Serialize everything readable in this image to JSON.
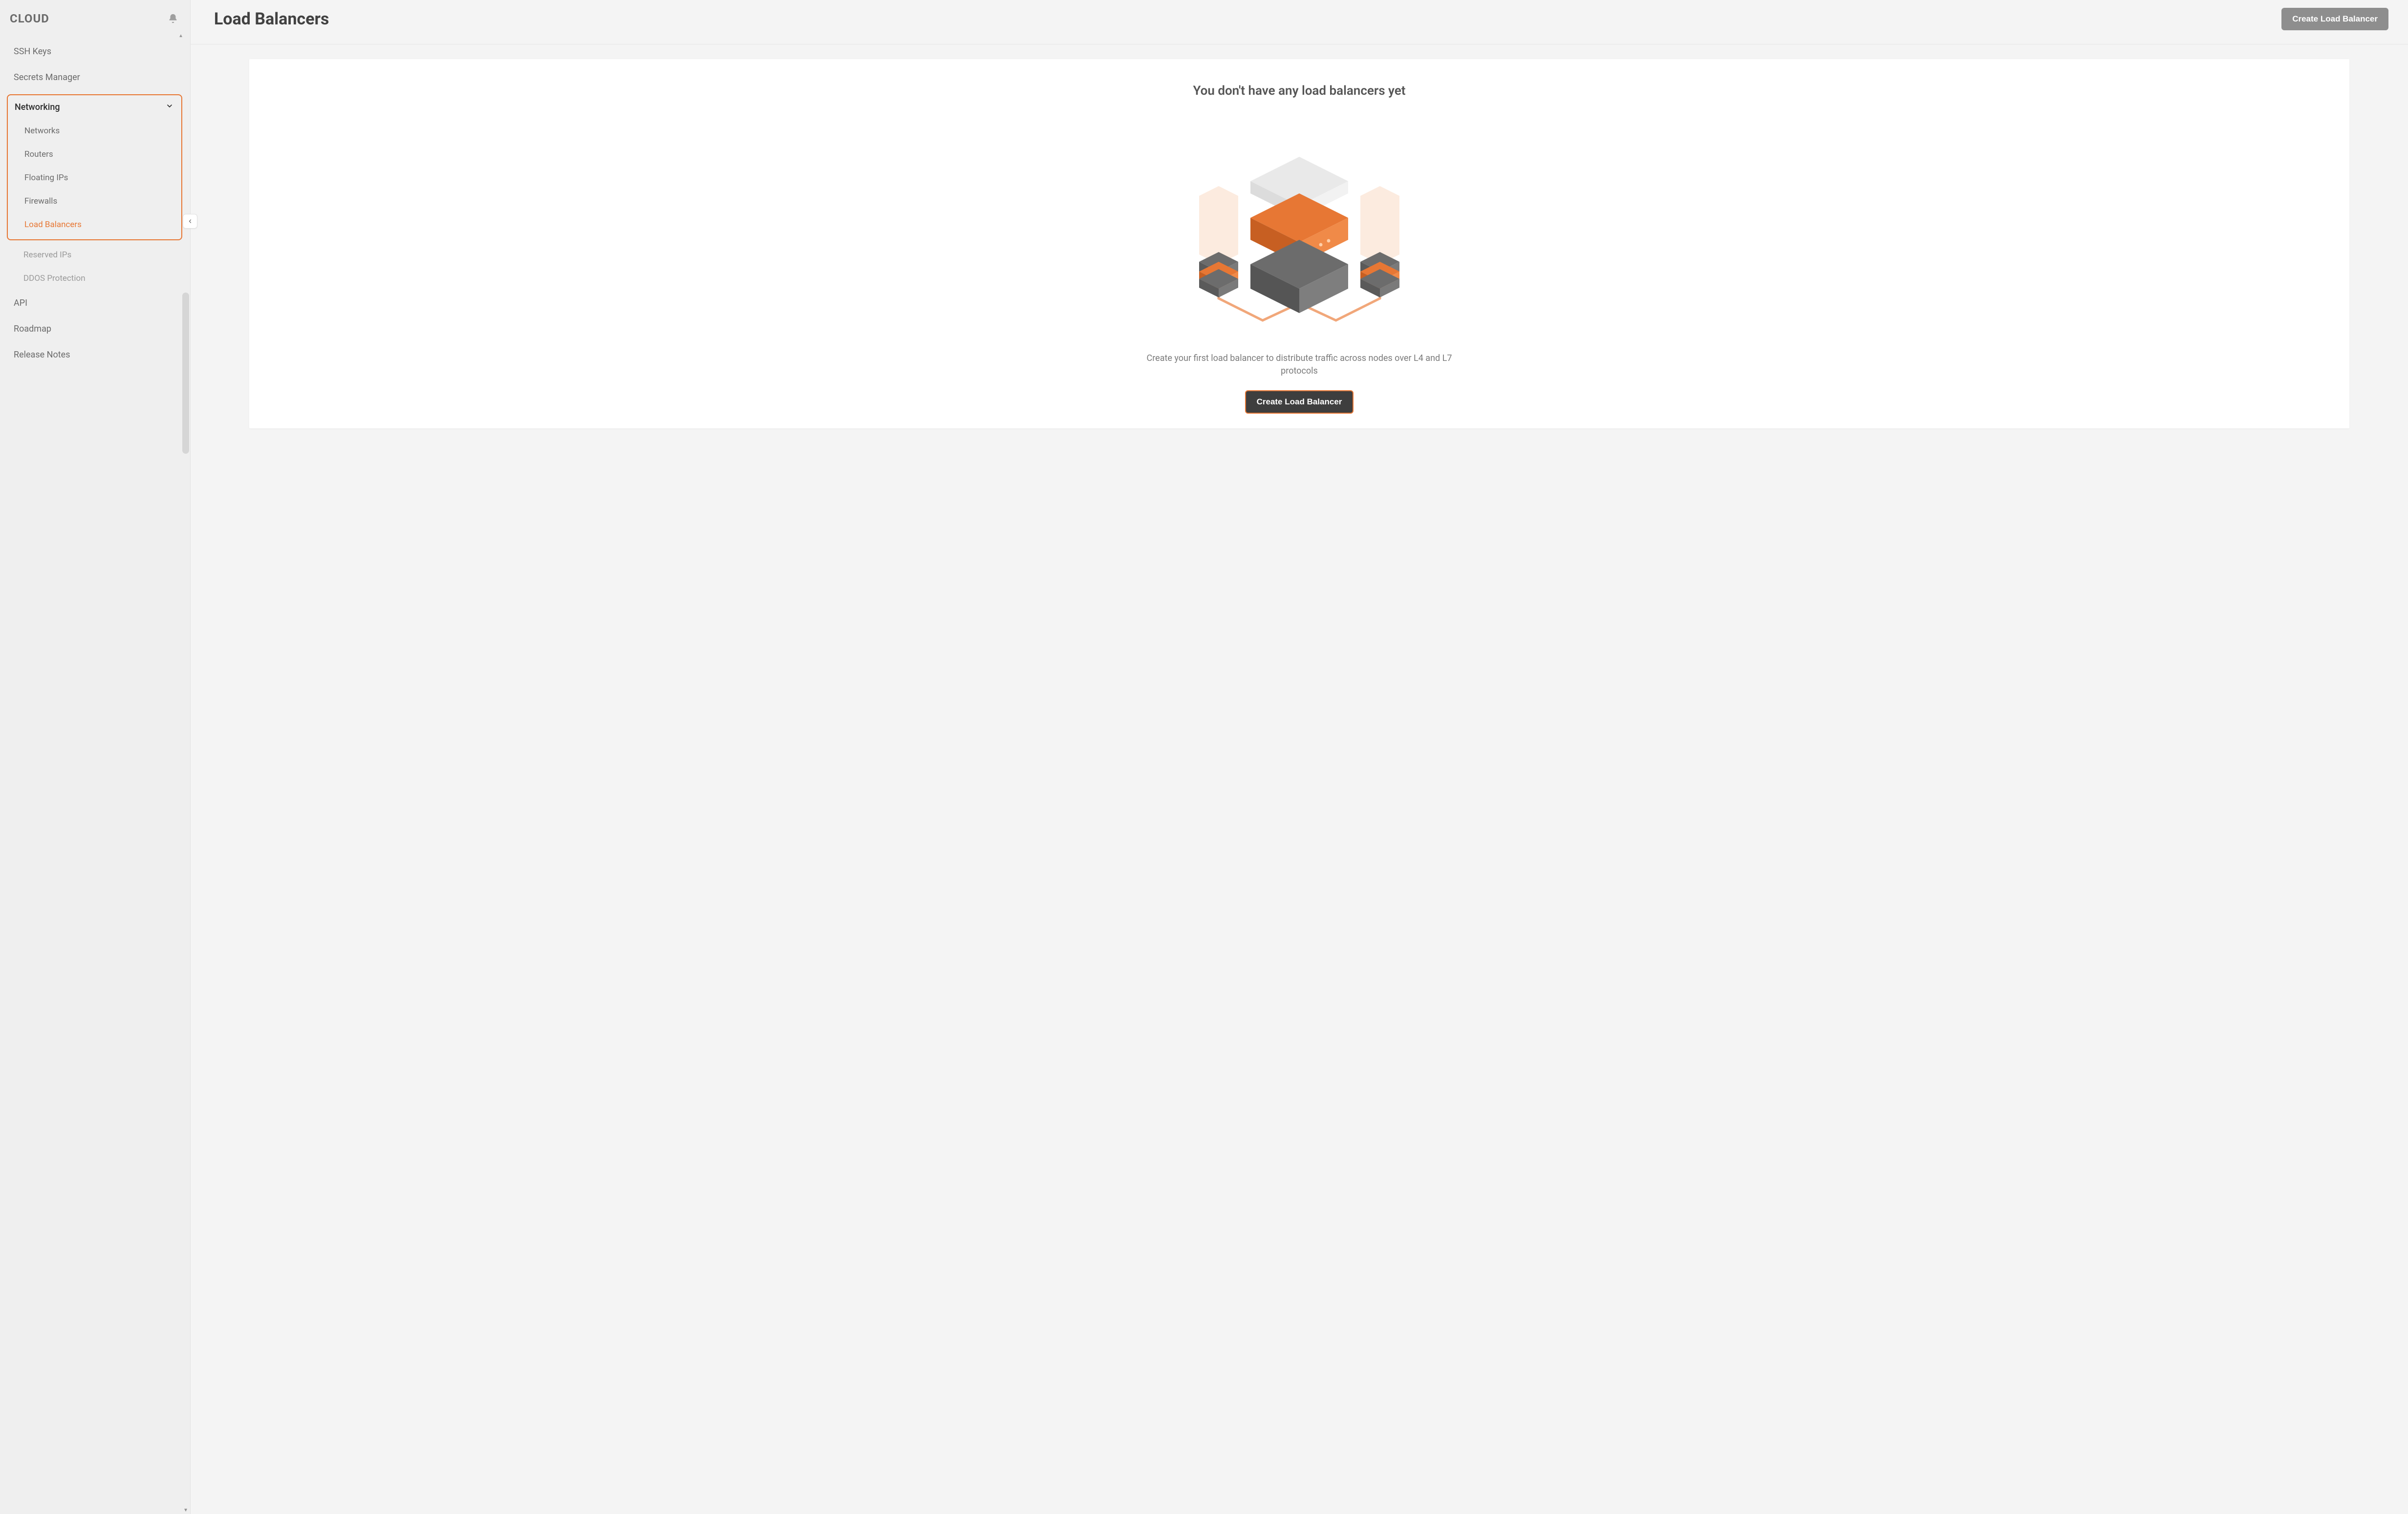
{
  "brand": "CLOUD",
  "sidebar": {
    "items_top": [
      {
        "label": "SSH Keys"
      },
      {
        "label": "Secrets Manager"
      }
    ],
    "group": {
      "label": "Networking",
      "children": [
        {
          "label": "Networks",
          "active": false
        },
        {
          "label": "Routers",
          "active": false
        },
        {
          "label": "Floating IPs",
          "active": false
        },
        {
          "label": "Firewalls",
          "active": false
        },
        {
          "label": "Load Balancers",
          "active": true
        }
      ]
    },
    "items_after_group": [
      {
        "label": "Reserved IPs"
      },
      {
        "label": "DDOS Protection"
      }
    ],
    "items_bottom": [
      {
        "label": "API"
      },
      {
        "label": "Roadmap"
      },
      {
        "label": "Release Notes"
      }
    ]
  },
  "header": {
    "title": "Load Balancers",
    "create_label": "Create Load Balancer"
  },
  "empty": {
    "title": "You don't have any load balancers yet",
    "description": "Create your first load balancer to distribute traffic across nodes over L4 and L7 protocols",
    "cta_label": "Create Load Balancer"
  },
  "colors": {
    "accent": "#e77734",
    "muted_button": "#8e8e8e",
    "dark_button": "#3e3e3e"
  }
}
